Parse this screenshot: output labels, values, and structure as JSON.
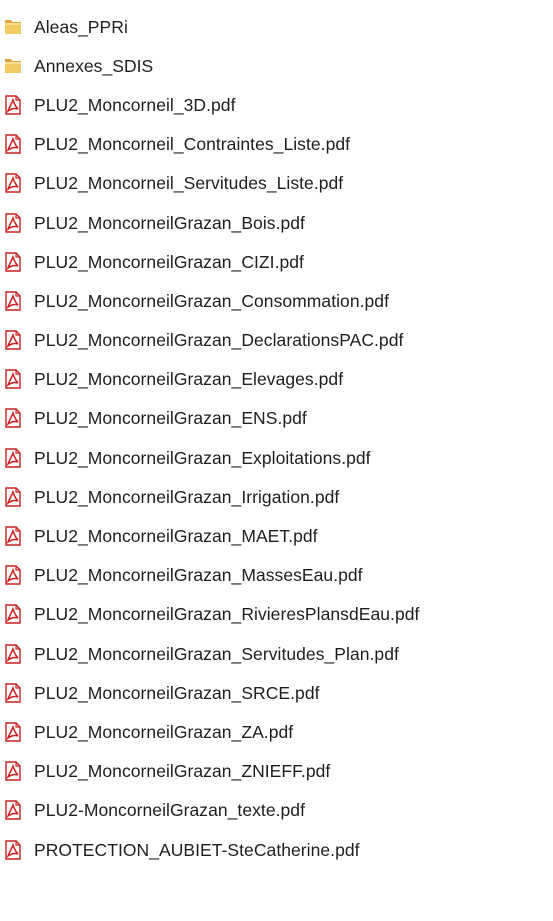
{
  "items": [
    {
      "name": "Aleas_PPRi",
      "icon": "folder-icon"
    },
    {
      "name": "Annexes_SDIS",
      "icon": "folder-icon"
    },
    {
      "name": "PLU2_Moncorneil_3D.pdf",
      "icon": "pdf-icon"
    },
    {
      "name": "PLU2_Moncorneil_Contraintes_Liste.pdf",
      "icon": "pdf-icon"
    },
    {
      "name": "PLU2_Moncorneil_Servitudes_Liste.pdf",
      "icon": "pdf-icon"
    },
    {
      "name": "PLU2_MoncorneilGrazan_Bois.pdf",
      "icon": "pdf-icon"
    },
    {
      "name": "PLU2_MoncorneilGrazan_CIZI.pdf",
      "icon": "pdf-icon"
    },
    {
      "name": "PLU2_MoncorneilGrazan_Consommation.pdf",
      "icon": "pdf-icon"
    },
    {
      "name": "PLU2_MoncorneilGrazan_DeclarationsPAC.pdf",
      "icon": "pdf-icon"
    },
    {
      "name": "PLU2_MoncorneilGrazan_Elevages.pdf",
      "icon": "pdf-icon"
    },
    {
      "name": "PLU2_MoncorneilGrazan_ENS.pdf",
      "icon": "pdf-icon"
    },
    {
      "name": "PLU2_MoncorneilGrazan_Exploitations.pdf",
      "icon": "pdf-icon"
    },
    {
      "name": "PLU2_MoncorneilGrazan_Irrigation.pdf",
      "icon": "pdf-icon"
    },
    {
      "name": "PLU2_MoncorneilGrazan_MAET.pdf",
      "icon": "pdf-icon"
    },
    {
      "name": "PLU2_MoncorneilGrazan_MassesEau.pdf",
      "icon": "pdf-icon"
    },
    {
      "name": "PLU2_MoncorneilGrazan_RivieresPlansdEau.pdf",
      "icon": "pdf-icon"
    },
    {
      "name": "PLU2_MoncorneilGrazan_Servitudes_Plan.pdf",
      "icon": "pdf-icon"
    },
    {
      "name": "PLU2_MoncorneilGrazan_SRCE.pdf",
      "icon": "pdf-icon"
    },
    {
      "name": "PLU2_MoncorneilGrazan_ZA.pdf",
      "icon": "pdf-icon"
    },
    {
      "name": "PLU2_MoncorneilGrazan_ZNIEFF.pdf",
      "icon": "pdf-icon"
    },
    {
      "name": "PLU2-MoncorneilGrazan_texte.pdf",
      "icon": "pdf-icon"
    },
    {
      "name": "PROTECTION_AUBIET-SteCatherine.pdf",
      "icon": "pdf-icon"
    }
  ],
  "colors": {
    "folder": "#e8b94a",
    "pdf_red": "#c8201e",
    "text": "#1e1e1e"
  }
}
